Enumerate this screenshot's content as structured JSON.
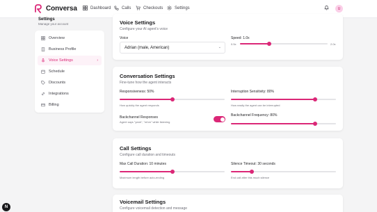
{
  "app": {
    "name": "Conversa",
    "brand_color": "#db2777"
  },
  "nav": {
    "items": [
      {
        "label": "Dashboard",
        "icon": "grid-icon"
      },
      {
        "label": "Calls",
        "icon": "phone-icon"
      },
      {
        "label": "Checkouts",
        "icon": "cart-icon"
      },
      {
        "label": "Settings",
        "icon": "gear-icon"
      }
    ],
    "avatar_initial": "U"
  },
  "sidebar": {
    "title": "Settings",
    "subtitle": "Manage your account",
    "items": [
      {
        "label": "Overview",
        "icon": "grid-icon",
        "active": false
      },
      {
        "label": "Business Profile",
        "icon": "building-icon",
        "active": false
      },
      {
        "label": "Voice Settings",
        "icon": "mic-icon",
        "active": true
      },
      {
        "label": "Schedule",
        "icon": "calendar-icon",
        "active": false
      },
      {
        "label": "Discounts",
        "icon": "tag-icon",
        "active": false
      },
      {
        "label": "Integrations",
        "icon": "link-icon",
        "active": false
      },
      {
        "label": "Billing",
        "icon": "card-icon",
        "active": false
      }
    ]
  },
  "voice": {
    "title": "Voice Settings",
    "subtitle": "Configure your AI agent's voice",
    "voice_label": "Voice",
    "voice_value": "Adrian (male, American)",
    "speed_label": "Speed: 1.0x",
    "speed_min": "0.5x",
    "speed_max": "2.0x",
    "speed_fraction": 0.33
  },
  "conversation": {
    "title": "Conversation Settings",
    "subtitle": "Fine-tune how the agent interacts",
    "responsiveness_label": "Responsiveness: 50%",
    "responsiveness_hint": "How quickly the agent responds",
    "responsiveness_fraction": 0.5,
    "interruption_label": "Interruption Sensitivity: 80%",
    "interruption_hint": "How easily the agent can be interrupted",
    "interruption_fraction": 0.8,
    "backchannel_label": "Backchannel Responses",
    "backchannel_hint": "Agent says \"yeah\", \"mhm\" while listening",
    "backchannel_enabled": true,
    "backchannel_freq_label": "Backchannel Frequency: 80%",
    "backchannel_freq_fraction": 0.8
  },
  "call": {
    "title": "Call Settings",
    "subtitle": "Configure call duration and timeouts",
    "max_duration_label": "Max Call Duration: 10 minutes",
    "max_duration_hint": "Maximum length before auto-ending",
    "max_duration_fraction": 0.5,
    "silence_label": "Silence Timeout: 30 seconds",
    "silence_hint": "End call after this much silence",
    "silence_fraction": 0.2
  },
  "voicemail": {
    "title": "Voicemail Settings",
    "subtitle": "Configure voicemail detection and message"
  },
  "fab": {
    "label": "N"
  }
}
